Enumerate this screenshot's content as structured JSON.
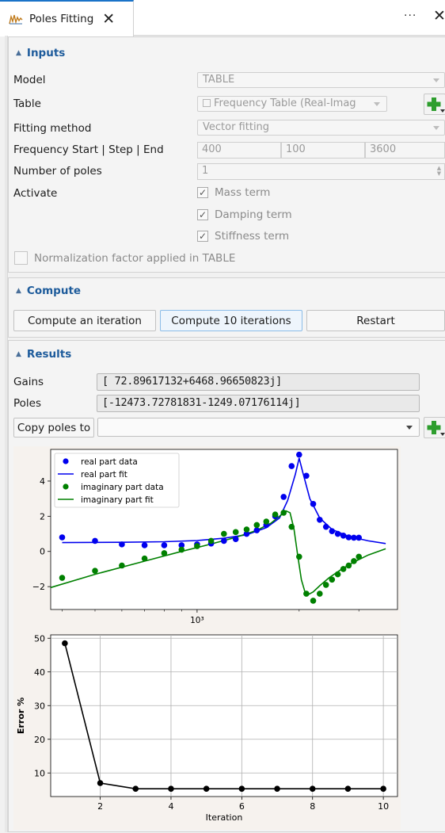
{
  "tab": {
    "title": "Poles Fitting",
    "close_glyph": "✕",
    "more_glyph": "···",
    "panel_close_glyph": "✕",
    "icon": "chart-line-icon"
  },
  "inputs": {
    "header": "Inputs",
    "model_label": "Model",
    "model_value": "TABLE",
    "table_label": "Table",
    "table_value": "Frequency Table (Real-Imag",
    "fitting_label": "Fitting method",
    "fitting_value": "Vector fitting",
    "freq_label": "Frequency Start | Step | End",
    "freq_start": "400",
    "freq_step": "100",
    "freq_end": "3600",
    "poles_label": "Number of poles",
    "poles_value": "1",
    "activate_label": "Activate",
    "mass_label": "Mass term",
    "damping_label": "Damping term",
    "stiffness_label": "Stiffness term",
    "mass_checked": true,
    "damping_checked": true,
    "stiffness_checked": true,
    "normalization_label": "Normalization factor applied in TABLE",
    "normalization_checked": false
  },
  "compute": {
    "header": "Compute",
    "one_label": "Compute an iteration",
    "ten_label": "Compute 10 iterations",
    "restart_label": "Restart"
  },
  "results": {
    "header": "Results",
    "gains_label": "Gains",
    "gains_value": "[ 72.89617132+6468.96650823j]",
    "poles_label": "Poles",
    "poles_value": "[-12473.72781831-1249.07176114j]",
    "copy_label": "Copy poles to",
    "copy_value": ""
  },
  "colors": {
    "accent": "#1d5b9b",
    "real": "#0000ee",
    "imag": "#008000",
    "error": "#000000",
    "plus": "#2e9e2e"
  },
  "chart_data": [
    {
      "type": "scatter",
      "xscale": "log",
      "xlabel": "",
      "ylabel": "",
      "x_ticklabel": "10³",
      "xlim": [
        370,
        3900
      ],
      "ylim": [
        -3.3,
        5.8
      ],
      "yticks": [
        -2,
        0,
        2,
        4
      ],
      "legend_location": "upper-left",
      "series": [
        {
          "name": "real part data",
          "kind": "points",
          "color": "#0000ee",
          "x": [
            400,
            500,
            600,
            700,
            800,
            900,
            1000,
            1100,
            1200,
            1300,
            1400,
            1500,
            1600,
            1700,
            1800,
            1900,
            2000,
            2100,
            2200,
            2300,
            2400,
            2500,
            2600,
            2700,
            2800,
            2900,
            3000
          ],
          "y": [
            0.8,
            0.6,
            0.4,
            0.35,
            0.35,
            0.35,
            0.4,
            0.45,
            0.6,
            0.7,
            1.0,
            1.2,
            1.5,
            2.0,
            3.1,
            4.85,
            5.5,
            4.3,
            2.7,
            1.8,
            1.4,
            1.15,
            1.0,
            0.9,
            0.8,
            0.78,
            0.78
          ]
        },
        {
          "name": "real part fit",
          "kind": "line",
          "color": "#0000ee",
          "x": [
            400,
            600,
            800,
            1000,
            1200,
            1400,
            1600,
            1750,
            1850,
            1950,
            2000,
            2050,
            2150,
            2300,
            2500,
            2800,
            3200,
            3600
          ],
          "y": [
            0.5,
            0.52,
            0.55,
            0.62,
            0.75,
            0.95,
            1.35,
            1.9,
            2.9,
            4.4,
            5.3,
            4.5,
            3.0,
            1.9,
            1.25,
            0.85,
            0.6,
            0.45
          ]
        },
        {
          "name": "imaginary part data",
          "kind": "points",
          "color": "#008000",
          "x": [
            400,
            500,
            600,
            700,
            800,
            900,
            1000,
            1100,
            1200,
            1300,
            1400,
            1500,
            1600,
            1700,
            1800,
            1900,
            2000,
            2100,
            2200,
            2300,
            2400,
            2500,
            2600,
            2700,
            2800,
            2900,
            3000
          ],
          "y": [
            -1.5,
            -1.1,
            -0.8,
            -0.4,
            -0.1,
            0.1,
            0.3,
            0.6,
            1.0,
            1.1,
            1.25,
            1.5,
            1.7,
            2.1,
            2.2,
            1.4,
            -0.3,
            -2.4,
            -2.8,
            -2.4,
            -1.9,
            -1.6,
            -1.3,
            -1.0,
            -0.8,
            -0.55,
            -0.3
          ]
        },
        {
          "name": "imaginary part fit",
          "kind": "line",
          "color": "#008000",
          "x": [
            370,
            500,
            700,
            900,
            1100,
            1300,
            1500,
            1650,
            1750,
            1830,
            1880,
            1930,
            1980,
            2030,
            2080,
            2130,
            2200,
            2300,
            2450,
            2650,
            2900,
            3200,
            3600
          ],
          "y": [
            -2.05,
            -1.3,
            -0.55,
            0.0,
            0.42,
            0.8,
            1.2,
            1.6,
            2.0,
            2.3,
            2.2,
            1.3,
            -0.2,
            -1.6,
            -2.3,
            -2.45,
            -2.3,
            -1.95,
            -1.5,
            -1.05,
            -0.6,
            -0.2,
            0.15
          ]
        }
      ]
    },
    {
      "type": "line",
      "xlabel": "Iteration",
      "ylabel": "Error %",
      "xlim": [
        0.6,
        10.4
      ],
      "ylim": [
        3,
        51
      ],
      "xticks": [
        2,
        4,
        6,
        8,
        10
      ],
      "yticks": [
        10,
        20,
        30,
        40,
        50
      ],
      "grid": true,
      "series": [
        {
          "name": "",
          "color": "#000000",
          "x": [
            1,
            2,
            3,
            4,
            5,
            6,
            7,
            8,
            9,
            10
          ],
          "y": [
            48.5,
            7.0,
            5.3,
            5.3,
            5.3,
            5.3,
            5.3,
            5.3,
            5.3,
            5.3
          ]
        }
      ]
    }
  ]
}
